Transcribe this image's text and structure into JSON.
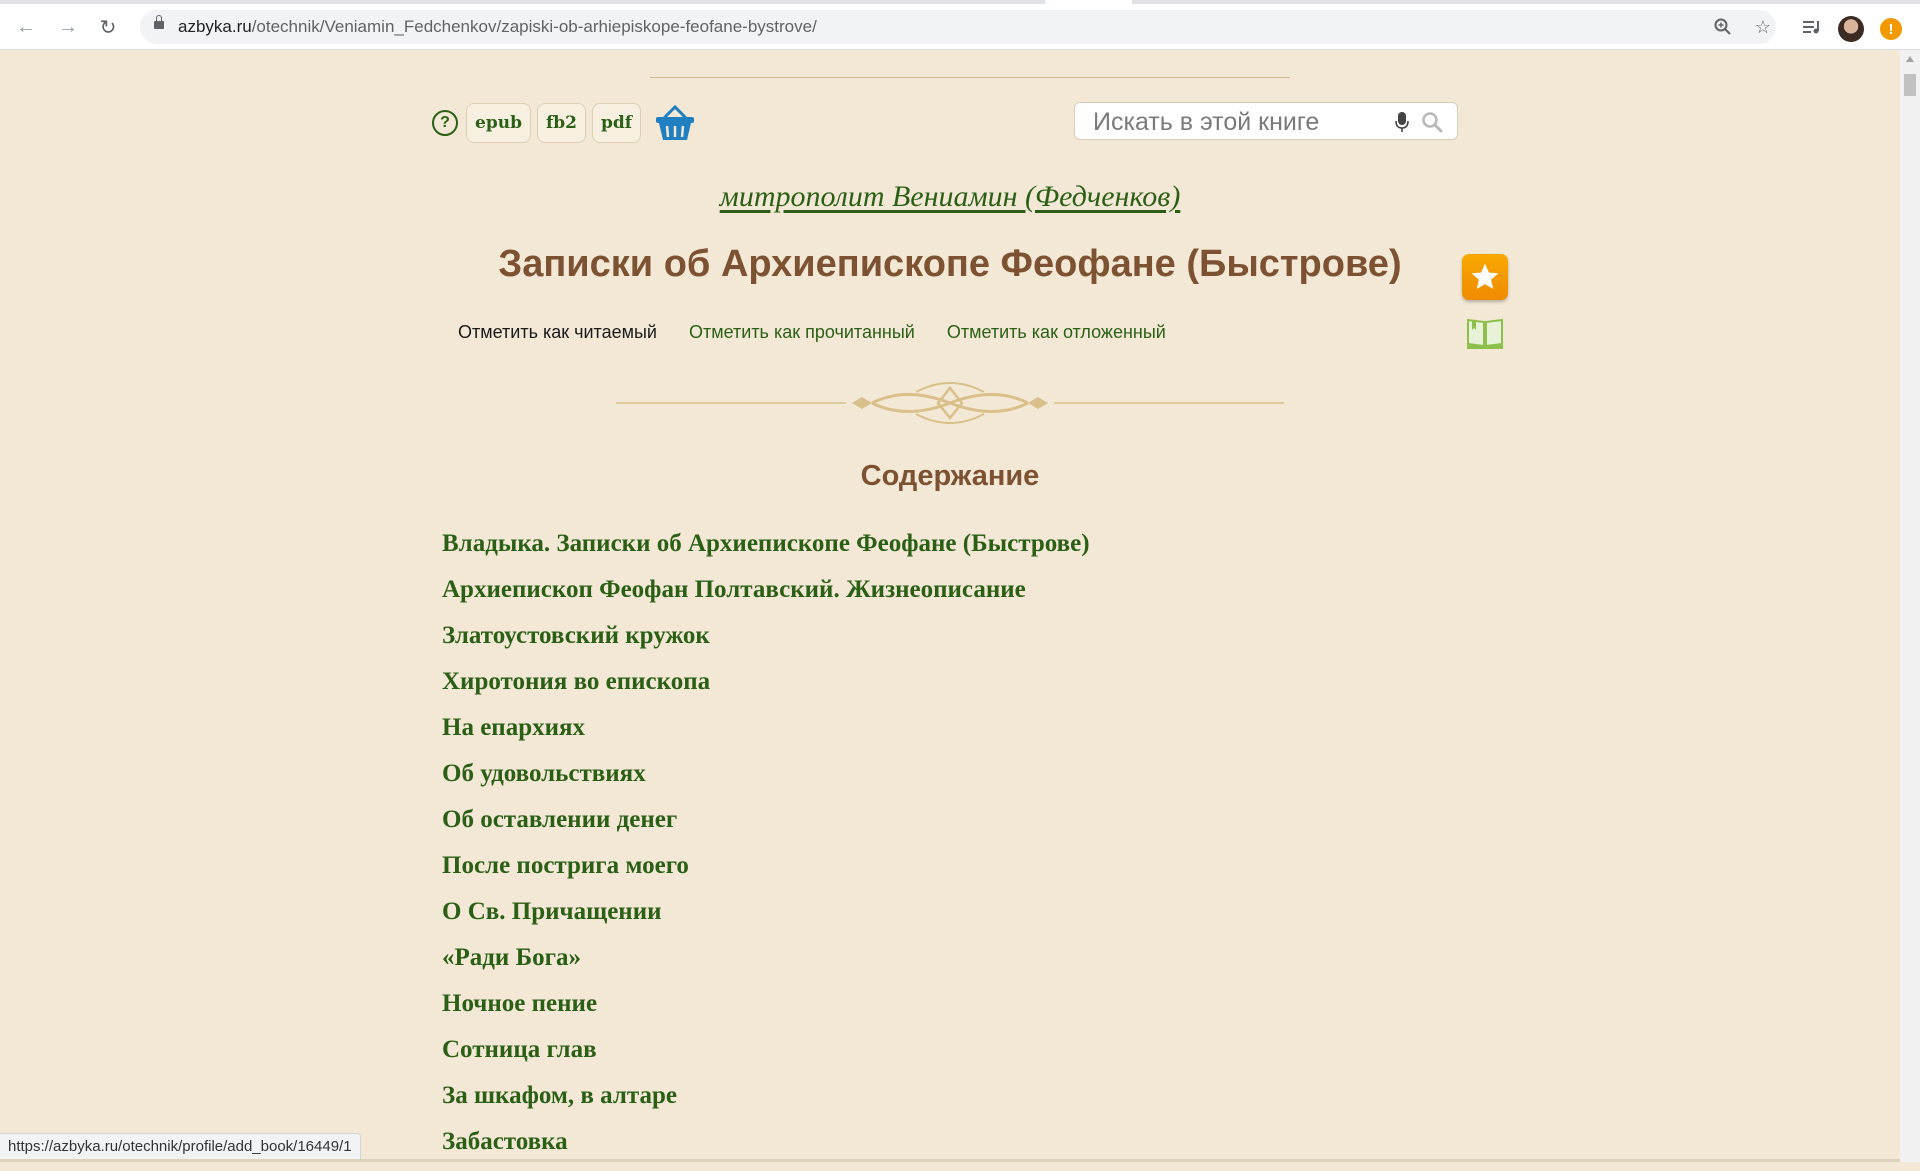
{
  "browser": {
    "url_host": "azbyka.ru",
    "url_path": "/otechnik/Veniamin_Fedchenkov/zapiski-ob-arhiepiskope-feofane-bystrove/",
    "status_url": "https://azbyka.ru/otechnik/profile/add_book/16449/1",
    "icons": [
      "back-icon",
      "forward-icon",
      "reload-icon",
      "lock-icon",
      "zoom-icon",
      "bookmark-star-icon",
      "media-queue-icon",
      "profile-avatar",
      "alert-icon"
    ]
  },
  "toolbar": {
    "help_label": "?",
    "formats": [
      "epub",
      "fb2",
      "pdf"
    ],
    "basket_icon": "basket-icon"
  },
  "search": {
    "placeholder": "Искать в этой книге",
    "icons": [
      "mic-icon",
      "search-icon"
    ]
  },
  "book": {
    "author": "митрополит Вениамин (Федченков)",
    "title": "Записки об Архиепископе Феофане (Быстрове)"
  },
  "marks": {
    "reading": "Отметить как читаемый",
    "read": "Отметить как прочитанный",
    "postponed": "Отметить как отложенный"
  },
  "toc": {
    "heading": "Содержание",
    "items": [
      "Владыка. Записки об Архиепископе Феофане (Быстрове)",
      "Архиепископ Феофан Полтавский. Жизнеописание",
      "Златоустовский кружок",
      "Хиротония во епископа",
      "На епархиях",
      "Об удовольствиях",
      "Об оставлении денег",
      "После пострига моего",
      "О Св. Причащении",
      "«Ради Бога»",
      "Ночное пение",
      "Сотница глав",
      "За шкафом, в алтаре",
      "Забастовка"
    ]
  },
  "colors": {
    "background": "#f2e8d5",
    "link_green": "#2c5f16",
    "title_brown": "#7c5232",
    "favorite_orange": "#f29900",
    "ornament_gold": "#d9c08a"
  }
}
